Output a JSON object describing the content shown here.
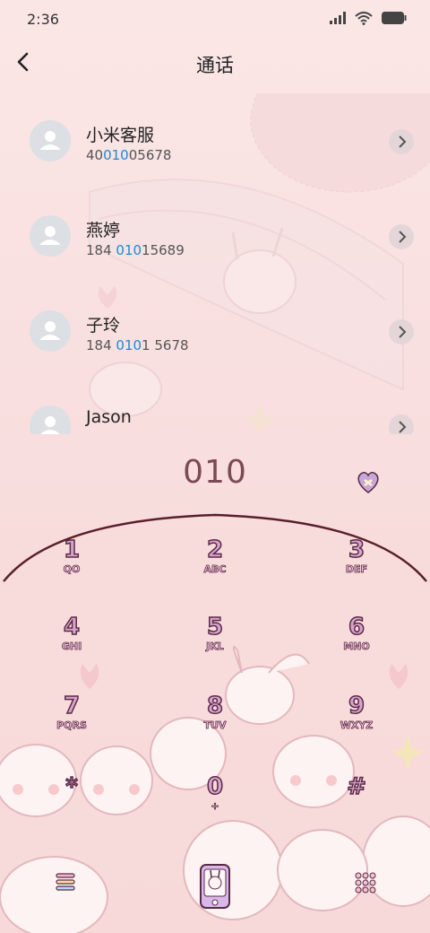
{
  "status": {
    "time": "2:36",
    "signal_icon": "signal-icon",
    "wifi_icon": "wifi-icon",
    "battery_icon": "battery-icon"
  },
  "header": {
    "title": "通话",
    "back_icon": "chevron-left-icon"
  },
  "contacts": [
    {
      "name": "小米客服",
      "num_pre": "40",
      "num_hl": "010",
      "num_post": "05678"
    },
    {
      "name": "燕婷",
      "num_pre": "184 ",
      "num_hl": "010",
      "num_post": "15689"
    },
    {
      "name": "子玲",
      "num_pre": "184 ",
      "num_hl": "010",
      "num_post": "1 5678"
    },
    {
      "name": "Jason",
      "num_pre": "",
      "num_hl": "",
      "num_post": ""
    }
  ],
  "dialer": {
    "input": "010"
  },
  "keys": [
    {
      "n": "1",
      "l": "QO"
    },
    {
      "n": "2",
      "l": "ABC"
    },
    {
      "n": "3",
      "l": "DEF"
    },
    {
      "n": "4",
      "l": "GHI"
    },
    {
      "n": "5",
      "l": "JKL"
    },
    {
      "n": "6",
      "l": "MNO"
    },
    {
      "n": "7",
      "l": "PQRS"
    },
    {
      "n": "8",
      "l": "TUV"
    },
    {
      "n": "9",
      "l": "WXYZ"
    },
    {
      "n": "*",
      "l": ""
    },
    {
      "n": "0",
      "l": "+"
    },
    {
      "n": "#",
      "l": ""
    }
  ],
  "colors": {
    "accent": "#1a8ad8",
    "digit": "#7a4a55",
    "key_outline": "#5a2b47"
  }
}
